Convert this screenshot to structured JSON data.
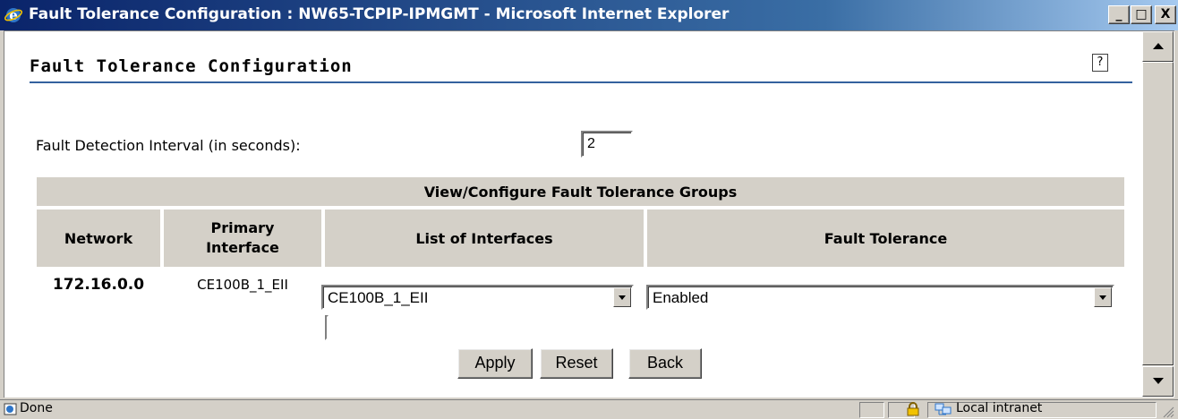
{
  "window": {
    "title": "Fault Tolerance Configuration : NW65-TCPIP-IPMGMT - Microsoft Internet Explorer",
    "minimize_glyph": "_",
    "maximize_glyph": "□",
    "close_glyph": "X"
  },
  "page": {
    "title": "Fault Tolerance Configuration",
    "help_glyph": "?"
  },
  "form": {
    "fault_detection_label": "Fault Detection Interval (in seconds):",
    "fault_detection_value": "2"
  },
  "table": {
    "caption": "View/Configure Fault Tolerance Groups",
    "headers": [
      "Network",
      "Primary Interface",
      "List of Interfaces",
      "Fault Tolerance"
    ],
    "rows": [
      {
        "network": "172.16.0.0",
        "primary_interface": "CE100B_1_EII",
        "interfaces_selected": "CE100B_1_EII",
        "fault_tolerance_selected": "Enabled"
      }
    ]
  },
  "buttons": {
    "apply": "Apply",
    "reset": "Reset",
    "back": "Back"
  },
  "statusbar": {
    "status": "Done",
    "zone": "Local intranet"
  },
  "icons": {
    "browser": "ie-icon",
    "lock": "lock-icon",
    "zone": "local-intranet-icon"
  },
  "colors": {
    "titlebar_start": "#0a246a",
    "titlebar_end": "#a6caf0",
    "rule": "#34619e",
    "chrome": "#d4d0c8"
  }
}
